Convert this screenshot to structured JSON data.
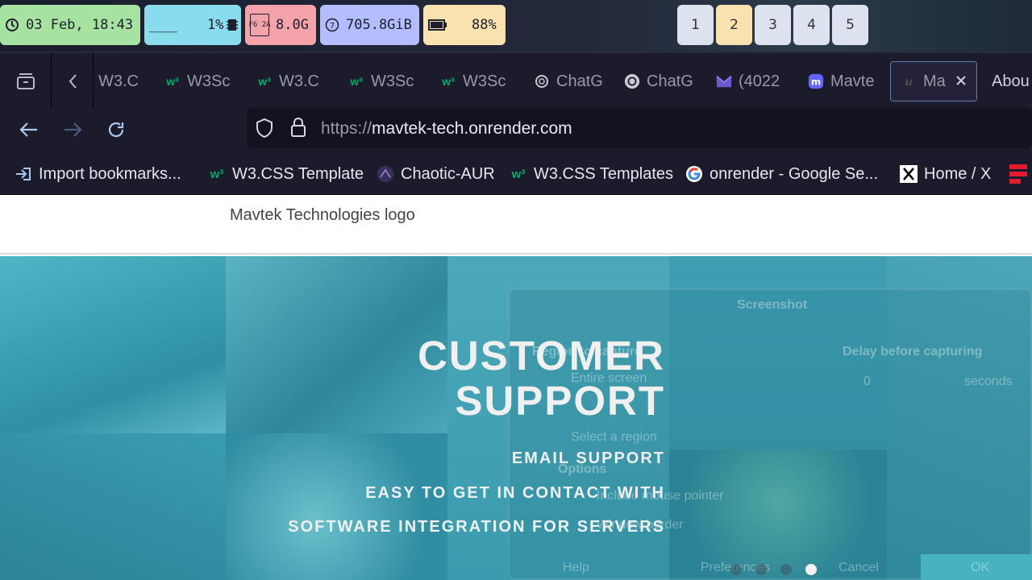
{
  "statusbar": {
    "clock": "03 Feb, 18:43",
    "cpu": "1%",
    "cpu_graph": "____",
    "memory": "8.0G",
    "disk": "705.8GiB",
    "battery": "88%",
    "memory_icon_text": "F6 2A",
    "workspaces": [
      "1",
      "2",
      "3",
      "4",
      "5"
    ],
    "active_workspace": "2"
  },
  "tabs": [
    {
      "label": "W3.C",
      "icon": "tab-icon"
    },
    {
      "label": "W3Sc",
      "icon": "w3-icon"
    },
    {
      "label": "W3.C",
      "icon": "w3-icon"
    },
    {
      "label": "W3Sc",
      "icon": "w3-icon"
    },
    {
      "label": "W3Sc",
      "icon": "w3-icon"
    },
    {
      "label": "ChatG",
      "icon": "openai-icon"
    },
    {
      "label": "ChatG",
      "icon": "openai-icon"
    },
    {
      "label": "(4022",
      "icon": "mail-icon"
    },
    {
      "label": "Mavte",
      "icon": "mastodon-icon"
    },
    {
      "label": "Ma",
      "icon": "mavtek-icon",
      "selected": true
    },
    {
      "label": "Abou",
      "icon": ""
    }
  ],
  "url": {
    "scheme": "https://",
    "host": "mavtek-tech.onrender.com"
  },
  "bookmarks": [
    {
      "label": "Import bookmarks...",
      "icon": "import-icon"
    },
    {
      "label": "W3.CSS Template",
      "icon": "w3-icon"
    },
    {
      "label": "Chaotic-AUR",
      "icon": "chaotic-icon"
    },
    {
      "label": "W3.CSS Templates",
      "icon": "w3-icon"
    },
    {
      "label": "onrender - Google Se...",
      "icon": "google-icon"
    },
    {
      "label": "Home / X",
      "icon": "x-icon"
    }
  ],
  "page": {
    "logo_alt": "Mavtek Technologies logo",
    "hero": {
      "title_line1": "CUSTOMER",
      "title_line2": "SUPPORT",
      "items": [
        "EMAIL SUPPORT",
        "EASY TO GET IN CONTACT WITH",
        "SOFTWARE INTEGRATION FOR SERVERS"
      ]
    },
    "background_ghost": {
      "dialog_title": "Screenshot",
      "region": "Region to capture",
      "entire": "Entire screen",
      "select_region": "Select a region",
      "options": "Options",
      "pointer": "Include mouse pointer",
      "border": "Window border",
      "delay": "Delay before capturing",
      "delay_value": "0",
      "seconds": "seconds",
      "help": "Help",
      "preferences": "Preferences",
      "cancel": "Cancel",
      "ok": "OK"
    },
    "carousel": {
      "slides": 4,
      "active": 4
    }
  },
  "colors": {
    "hero_bg": "#3aa0b4",
    "statusbar_green": "#a6e3a1",
    "statusbar_cyan": "#89dceb",
    "statusbar_pink": "#f4a3ab",
    "statusbar_lavender": "#b4befe",
    "statusbar_yellow": "#f9e2af",
    "browser_bg": "#1c1b2c"
  }
}
